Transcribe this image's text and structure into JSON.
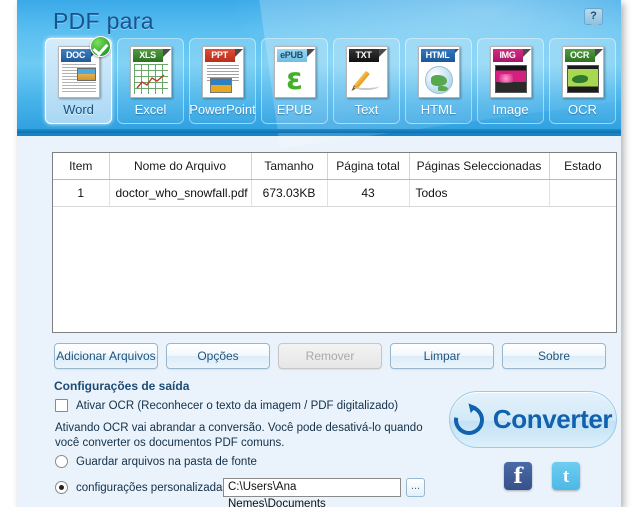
{
  "window": {
    "title": "PDF para",
    "help_icon": "help-question-icon"
  },
  "tabs": [
    {
      "label": "Word",
      "badge": "DOC",
      "selected": true,
      "icon": "doc-file-icon"
    },
    {
      "label": "Excel",
      "badge": "XLS",
      "selected": false,
      "icon": "xls-file-icon"
    },
    {
      "label": "PowerPoint",
      "badge": "PPT",
      "selected": false,
      "icon": "ppt-file-icon"
    },
    {
      "label": "EPUB",
      "badge": "ePUB",
      "selected": false,
      "icon": "epub-file-icon"
    },
    {
      "label": "Text",
      "badge": "TXT",
      "selected": false,
      "icon": "txt-file-icon"
    },
    {
      "label": "HTML",
      "badge": "HTML",
      "selected": false,
      "icon": "html-file-icon"
    },
    {
      "label": "Image",
      "badge": "IMG",
      "selected": false,
      "icon": "img-file-icon"
    },
    {
      "label": "OCR",
      "badge": "OCR",
      "selected": false,
      "icon": "ocr-file-icon"
    }
  ],
  "table": {
    "columns": [
      "Item",
      "Nome do Arquivo",
      "Tamanho",
      "Página total",
      "Páginas Seleccionadas",
      "Estado"
    ],
    "rows": [
      {
        "item": "1",
        "name": "doctor_who_snowfall.pdf",
        "size": "673.03KB",
        "pages_total": "43",
        "pages_selected": "Todos",
        "state": ""
      }
    ]
  },
  "buttons": {
    "add_files": "Adicionar Arquivos",
    "options": "Opções",
    "remove": "Remover",
    "clear": "Limpar",
    "about": "Sobre"
  },
  "output": {
    "section_title": "Configurações de saída",
    "ocr_checkbox_label": "Ativar OCR (Reconhecer o texto da imagem / PDF digitalizado)",
    "ocr_checked": false,
    "ocr_note": "Ativando OCR vai abrandar a conversão. Você pode desativá-lo quando você converter os documentos PDF comuns.",
    "radio_source_folder": "Guardar arquivos na pasta de fonte",
    "radio_custom": "configurações personalizadas",
    "selected_radio": "custom",
    "path_value": "C:\\Users\\Ana Nemes\\Documents",
    "browse_label": "..."
  },
  "convert": {
    "label": "Converter",
    "icon": "refresh-circle-arrow-icon"
  },
  "social": [
    {
      "name": "facebook-icon",
      "glyph": "f"
    },
    {
      "name": "twitter-icon",
      "glyph": "t"
    }
  ],
  "colors": {
    "header_blue": "#58bef0",
    "accent_blue": "#1061ae",
    "title_blue": "#19538f",
    "facebook": "#3b5998",
    "twitter": "#55acee",
    "check_green": "#2aa42a"
  }
}
